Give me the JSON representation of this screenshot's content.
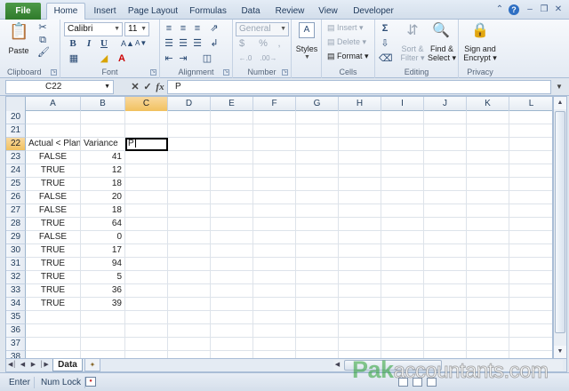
{
  "ribbon_tabs": [
    "Home",
    "Insert",
    "Page Layout",
    "Formulas",
    "Data",
    "Review",
    "View",
    "Developer"
  ],
  "file_tab": "File",
  "active_tab": "Home",
  "groups": {
    "clipboard": {
      "label": "Clipboard",
      "paste": "Paste"
    },
    "font": {
      "label": "Font",
      "family": "Calibri",
      "size": "11",
      "bold": "B",
      "italic": "I",
      "underline": "U"
    },
    "alignment": {
      "label": "Alignment"
    },
    "number": {
      "label": "Number",
      "format": "General",
      "currency": "$",
      "percent": "%"
    },
    "styles": {
      "label": "Styles"
    },
    "cells": {
      "label": "Cells",
      "insert": "Insert",
      "delete": "Delete",
      "format": "Format"
    },
    "editing": {
      "label": "Editing",
      "sort_filter_line1": "Sort &",
      "sort_filter_line2": "Filter",
      "find_select_line1": "Find &",
      "find_select_line2": "Select"
    },
    "privacy": {
      "label": "Privacy",
      "sign_line1": "Sign and",
      "sign_line2": "Encrypt"
    }
  },
  "formula_bar": {
    "name_box": "C22",
    "fx": "fx",
    "value": "P"
  },
  "columns": [
    "A",
    "B",
    "C",
    "D",
    "E",
    "F",
    "G",
    "H",
    "I",
    "J",
    "K",
    "L"
  ],
  "selected_column": "C",
  "rows": [
    {
      "num": "20",
      "a": "",
      "b": "",
      "c": ""
    },
    {
      "num": "21",
      "a": "",
      "b": "",
      "c": ""
    },
    {
      "num": "22",
      "a": "Actual < Plan",
      "b": "Variance",
      "c": "P"
    },
    {
      "num": "23",
      "a": "FALSE",
      "b": "41",
      "c": ""
    },
    {
      "num": "24",
      "a": "TRUE",
      "b": "12",
      "c": ""
    },
    {
      "num": "25",
      "a": "TRUE",
      "b": "18",
      "c": ""
    },
    {
      "num": "26",
      "a": "FALSE",
      "b": "20",
      "c": ""
    },
    {
      "num": "27",
      "a": "FALSE",
      "b": "18",
      "c": ""
    },
    {
      "num": "28",
      "a": "TRUE",
      "b": "64",
      "c": ""
    },
    {
      "num": "29",
      "a": "FALSE",
      "b": "0",
      "c": ""
    },
    {
      "num": "30",
      "a": "TRUE",
      "b": "17",
      "c": ""
    },
    {
      "num": "31",
      "a": "TRUE",
      "b": "94",
      "c": ""
    },
    {
      "num": "32",
      "a": "TRUE",
      "b": "5",
      "c": ""
    },
    {
      "num": "33",
      "a": "TRUE",
      "b": "36",
      "c": ""
    },
    {
      "num": "34",
      "a": "TRUE",
      "b": "39",
      "c": ""
    },
    {
      "num": "35",
      "a": "",
      "b": "",
      "c": ""
    },
    {
      "num": "36",
      "a": "",
      "b": "",
      "c": ""
    },
    {
      "num": "37",
      "a": "",
      "b": "",
      "c": ""
    },
    {
      "num": "38",
      "a": "",
      "b": "",
      "c": ""
    }
  ],
  "selected_row": "22",
  "sheet_tab": "Data",
  "status": {
    "mode": "Enter",
    "num_lock": "Num Lock"
  },
  "watermark": {
    "head": "Pak",
    "tail": "accountants.com"
  }
}
